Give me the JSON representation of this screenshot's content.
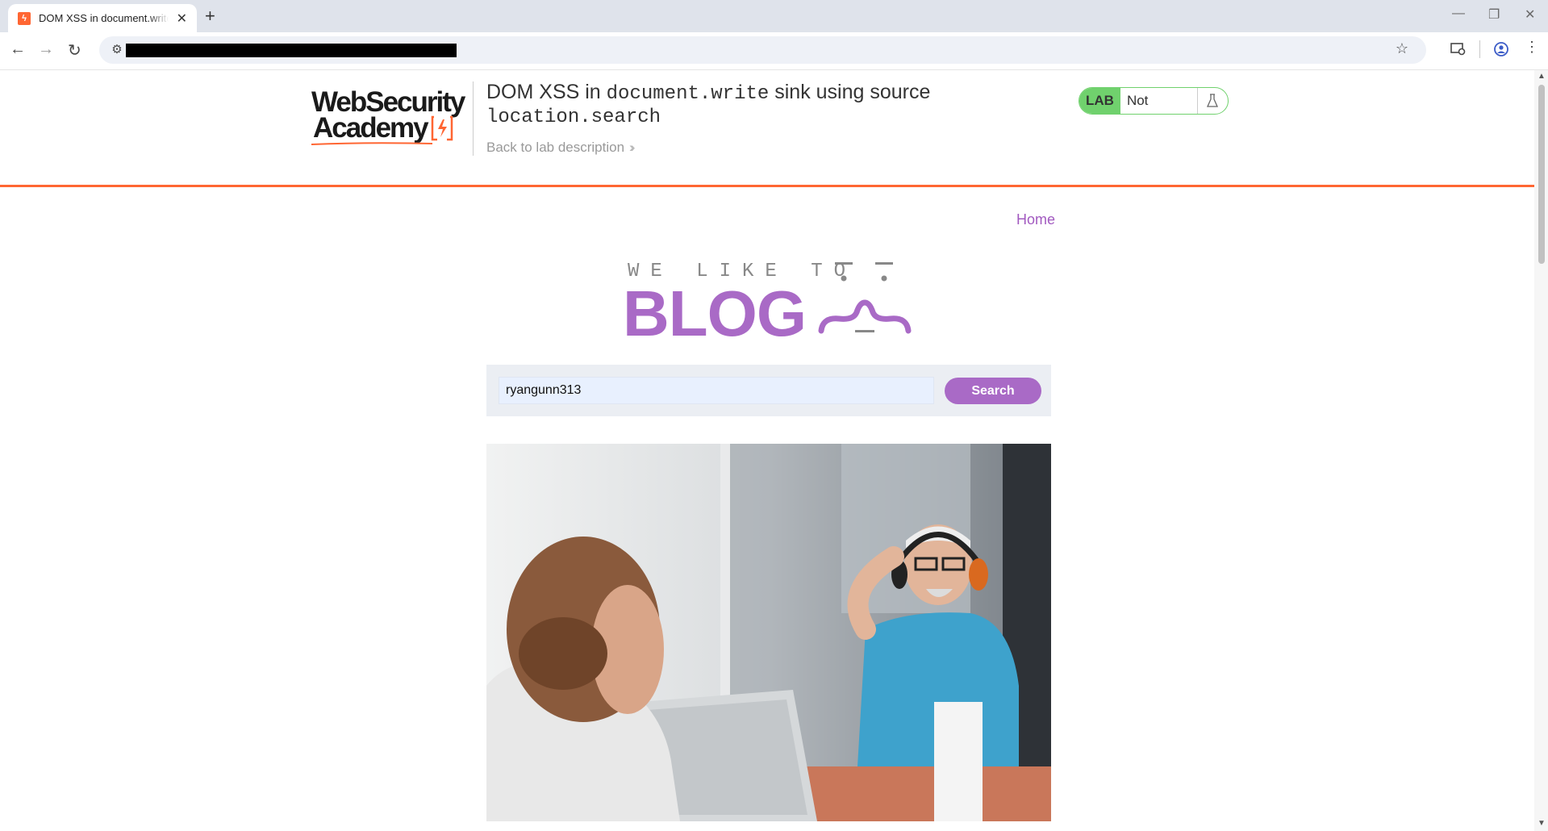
{
  "browser": {
    "tab_title": "DOM XSS in document.write sink using source location.search",
    "new_tab_icon": "plus-icon",
    "window_controls": [
      "minimize-icon",
      "restore-icon",
      "close-icon"
    ]
  },
  "lab_header": {
    "logo_line1": "WebSecurity",
    "logo_line2": "Academy",
    "title_prefix": "DOM XSS in ",
    "title_code1": "document.write",
    "title_middle": " sink using source ",
    "title_code2": "location.search",
    "back_link": "Back to lab description",
    "lab_badge": "LAB",
    "lab_status": "Not solved",
    "brand_color": "#ff6633",
    "status_color": "#70d16d"
  },
  "blog": {
    "nav_home": "Home",
    "logo_top": "WE LIKE TO",
    "logo_main": "BLOG",
    "accent_color": "#a96ac6"
  },
  "search": {
    "value": "ryangunn313",
    "button_label": "Search"
  }
}
